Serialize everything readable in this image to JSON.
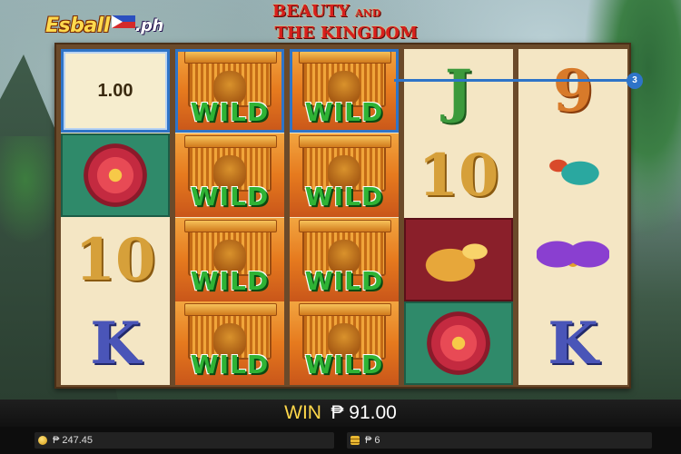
{
  "logo": {
    "main": "Esball",
    "suffix": ".ph"
  },
  "game_title": {
    "line1_a": "BEAUTY",
    "line1_b": "AND",
    "line2": "THE KINGDOM"
  },
  "reels": [
    {
      "symbols": [
        "1.00",
        "flower-symbol",
        "10",
        "K"
      ]
    },
    {
      "symbols": [
        "WILD",
        "WILD",
        "WILD",
        "WILD"
      ]
    },
    {
      "symbols": [
        "WILD",
        "WILD",
        "WILD",
        "WILD"
      ]
    },
    {
      "symbols": [
        "J",
        "10",
        "phoenix-symbol",
        "flower-symbol"
      ]
    },
    {
      "symbols": [
        "9",
        "bird-symbol",
        "butterfly-symbol",
        "K"
      ]
    }
  ],
  "value_cell": "1.00",
  "wild_label": "WILD",
  "payline_number": "3",
  "win": {
    "label": "WIN",
    "amount": "₱ 91.00"
  },
  "status": {
    "balance": "₱ 247.45",
    "bet": "₱ 6"
  },
  "colors": {
    "highlight": "#2e74c8",
    "wild_text": "#2fb335",
    "win_label": "#ffd84a",
    "title": "#d8201c"
  }
}
